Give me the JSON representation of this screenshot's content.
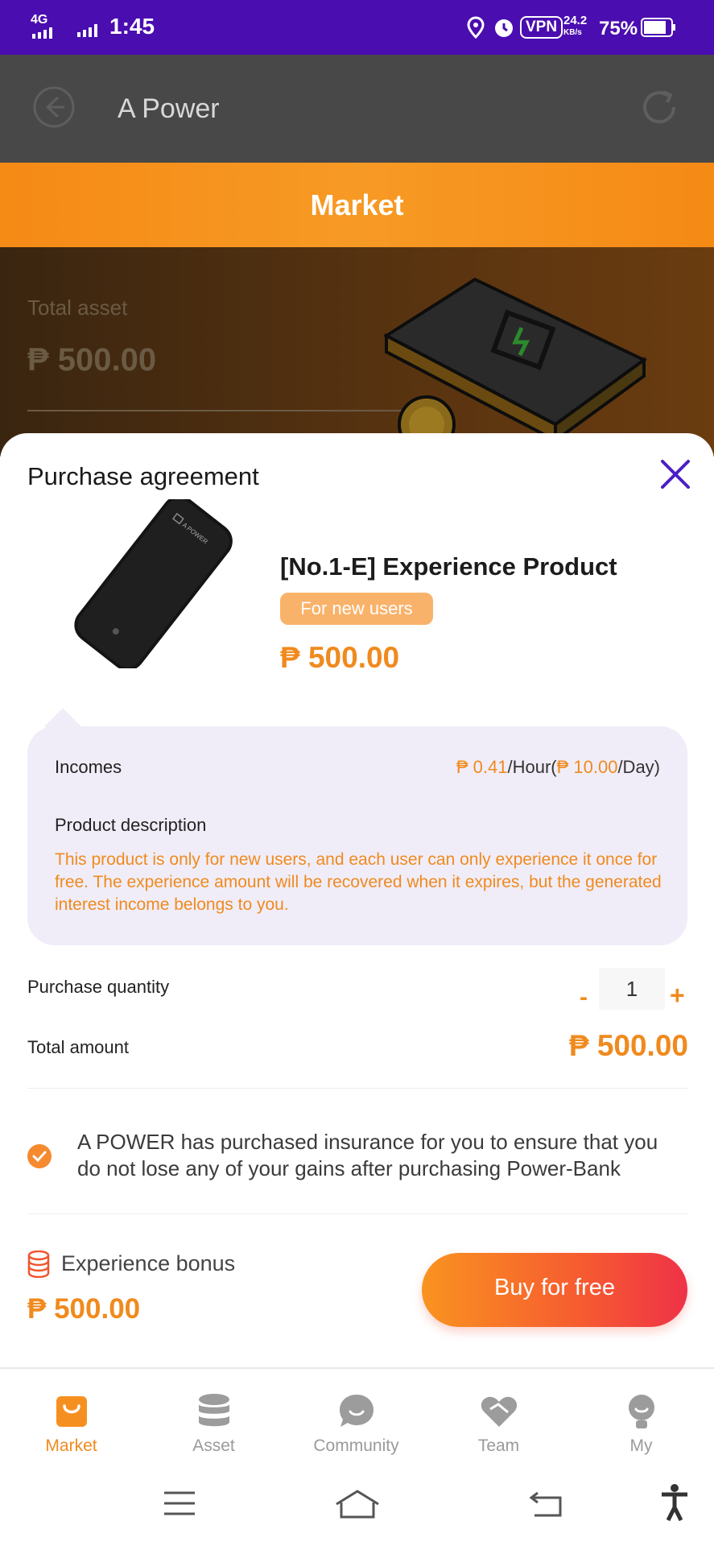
{
  "status_bar": {
    "signal": "4G",
    "time": "1:45",
    "vpn": "VPN",
    "speed": "24.2",
    "speed_unit": "KB/s",
    "battery": "75%"
  },
  "header": {
    "title": "A Power"
  },
  "market_bar": {
    "label": "Market"
  },
  "background": {
    "total_asset_label": "Total asset",
    "total_asset_value": "₱ 500.00"
  },
  "sheet": {
    "title": "Purchase agreement",
    "product": {
      "name": "[No.1-E] Experience Product",
      "badge": "For new users",
      "price": "₱ 500.00",
      "device_brand": "A POWER"
    },
    "info": {
      "incomes_label": "Incomes",
      "incomes_hour": "₱ 0.41",
      "incomes_hour_unit": "/Hour(",
      "incomes_day": "₱ 10.00",
      "incomes_day_unit": "/Day)",
      "description_label": "Product description",
      "description_text": "This product is only for new users, and each user can only experience it once for free. The experience amount will be recovered when it expires, but the generated interest income belongs to you."
    },
    "quantity_label": "Purchase quantity",
    "quantity_minus": "-",
    "quantity_value": "1",
    "quantity_plus": "+",
    "total_label": "Total amount",
    "total_value": "₱ 500.00",
    "insurance_text": "A POWER has purchased insurance for you to ensure that you do not lose any of your gains after purchasing Power-Bank",
    "bonus_label": "Experience bonus",
    "bonus_value": "₱ 500.00",
    "buy_button": "Buy for free"
  },
  "tabs": [
    {
      "label": "Market",
      "icon": "shopping-bag-icon",
      "active": true
    },
    {
      "label": "Asset",
      "icon": "database-icon",
      "active": false
    },
    {
      "label": "Community",
      "icon": "chat-icon",
      "active": false
    },
    {
      "label": "Team",
      "icon": "handshake-heart-icon",
      "active": false
    },
    {
      "label": "My",
      "icon": "user-icon",
      "active": false
    }
  ],
  "colors": {
    "accent": "#f08a1e",
    "status_bar": "#4a0db0",
    "close_icon": "#4b1fc4"
  }
}
